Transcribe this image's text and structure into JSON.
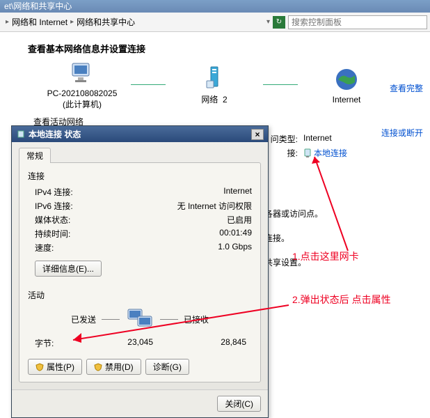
{
  "title_bar": "et\\网络和共享中心",
  "breadcrumb": {
    "item1": "网络和 Internet",
    "item2": "网络和共享中心",
    "search_placeholder": "搜索控制面板"
  },
  "heading": "查看基本网络信息并设置连接",
  "see_full": "查看完整",
  "net_map": {
    "pc_name": "PC-202108082025",
    "pc_sub": "(此计算机)",
    "network": "网络",
    "network_num": "2",
    "internet": "Internet"
  },
  "active_label": "查看活动网络",
  "conn_disconnect": "连接或断开",
  "side": {
    "type_key": "问类型:",
    "type_val": "Internet",
    "conn_key": "接:",
    "conn_val": "本地连接",
    "t1": "各器或访问点。",
    "t2": "连接。",
    "t3": "共享设置。",
    "t4": "。"
  },
  "dialog": {
    "title": "本地连接 状态",
    "tab": "常规",
    "conn_label": "连接",
    "rows": {
      "ipv4_k": "IPv4 连接:",
      "ipv4_v": "Internet",
      "ipv6_k": "IPv6 连接:",
      "ipv6_v": "无 Internet 访问权限",
      "media_k": "媒体状态:",
      "media_v": "已启用",
      "dur_k": "持续时间:",
      "dur_v": "00:01:49",
      "speed_k": "速度:",
      "speed_v": "1.0 Gbps"
    },
    "details_btn": "详细信息(E)...",
    "activity_label": "活动",
    "sent": "已发送",
    "recv": "已接收",
    "bytes_label": "字节:",
    "bytes_sent": "23,045",
    "bytes_recv": "28,845",
    "btn_props": "属性(P)",
    "btn_disable": "禁用(D)",
    "btn_diag": "诊断(G)",
    "btn_close": "关闭(C)"
  },
  "anno1": "1.点击这里网卡",
  "anno2": "2.弹出状态后 点击属性"
}
